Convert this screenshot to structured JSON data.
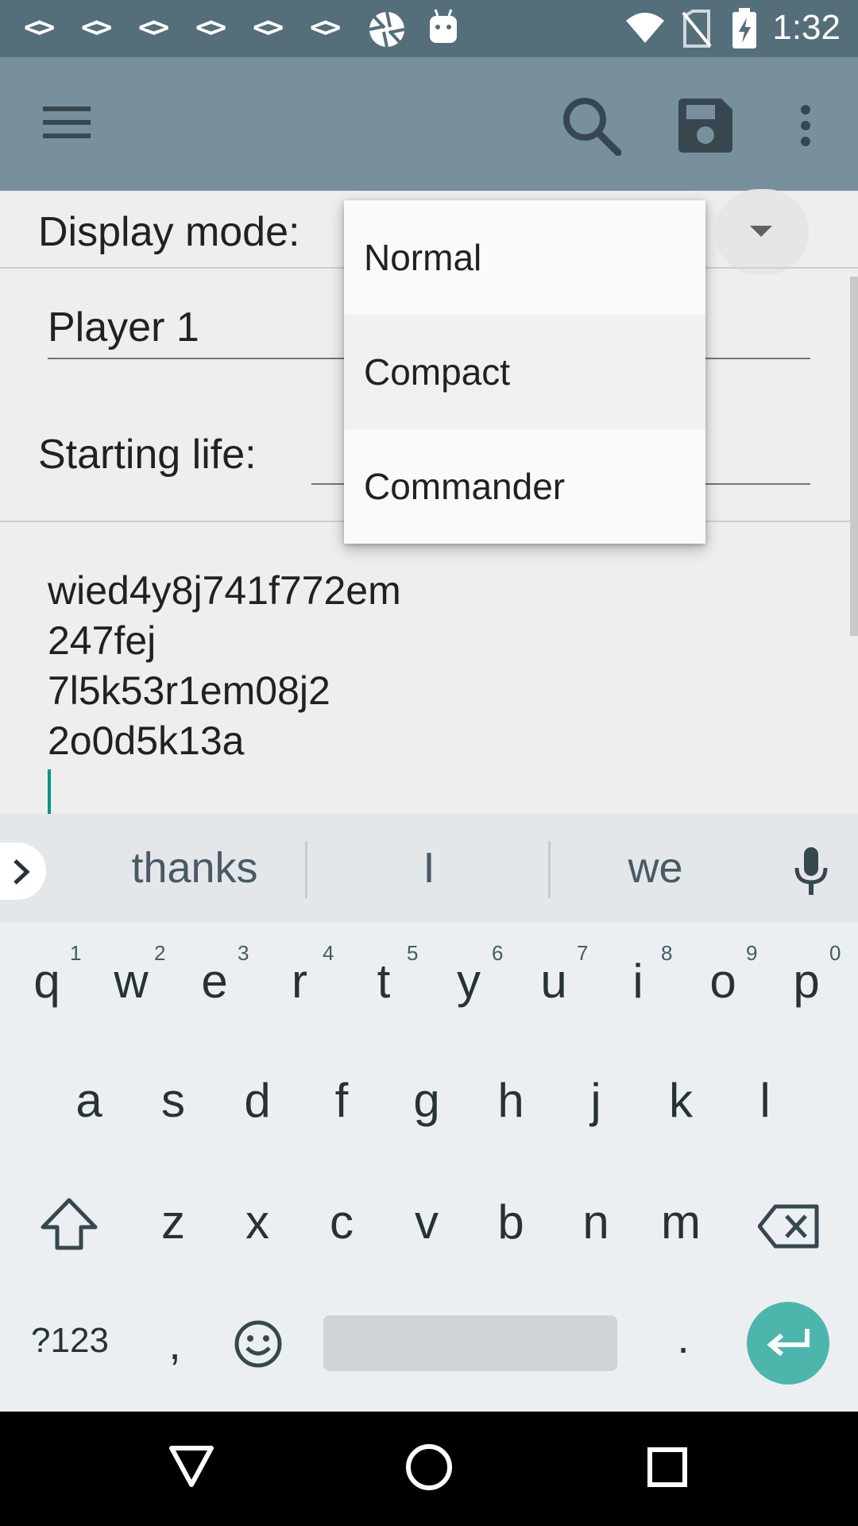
{
  "status_bar": {
    "time": "1:32",
    "notification_icons": [
      "code-icon",
      "code-icon",
      "code-icon",
      "code-icon",
      "code-icon",
      "code-icon",
      "aperture-icon",
      "android-icon"
    ],
    "system_icons": [
      "wifi-icon",
      "no-sim-icon",
      "battery-charging-icon"
    ]
  },
  "toolbar": {
    "menu_icon": "hamburger-menu-icon",
    "search_icon": "search-icon",
    "save_icon": "save-icon",
    "overflow_icon": "more-vert-icon"
  },
  "form": {
    "display_mode_label": "Display mode:",
    "player_name_value": "Player 1",
    "starting_life_label": "Starting life:",
    "notes_lines": [
      "wied4y8j741f772em",
      "247fej",
      "7l5k53r1em08j2",
      "2o0d5k13a"
    ]
  },
  "dropdown": {
    "options": [
      "Normal",
      "Compact",
      "Commander"
    ]
  },
  "keyboard": {
    "suggestions": [
      "thanks",
      "I",
      "we"
    ],
    "row1": [
      "q",
      "w",
      "e",
      "r",
      "t",
      "y",
      "u",
      "i",
      "o",
      "p"
    ],
    "row1_hints": [
      "1",
      "2",
      "3",
      "4",
      "5",
      "6",
      "7",
      "8",
      "9",
      "0"
    ],
    "row2": [
      "a",
      "s",
      "d",
      "f",
      "g",
      "h",
      "j",
      "k",
      "l"
    ],
    "row3": [
      "z",
      "x",
      "c",
      "v",
      "b",
      "n",
      "m"
    ],
    "symbols_key": "?123",
    "comma_key": ",",
    "period_key": "."
  },
  "colors": {
    "status_bar": "#546e7a",
    "toolbar": "#78909c",
    "accent": "#4db6ac",
    "cursor": "#009688"
  }
}
